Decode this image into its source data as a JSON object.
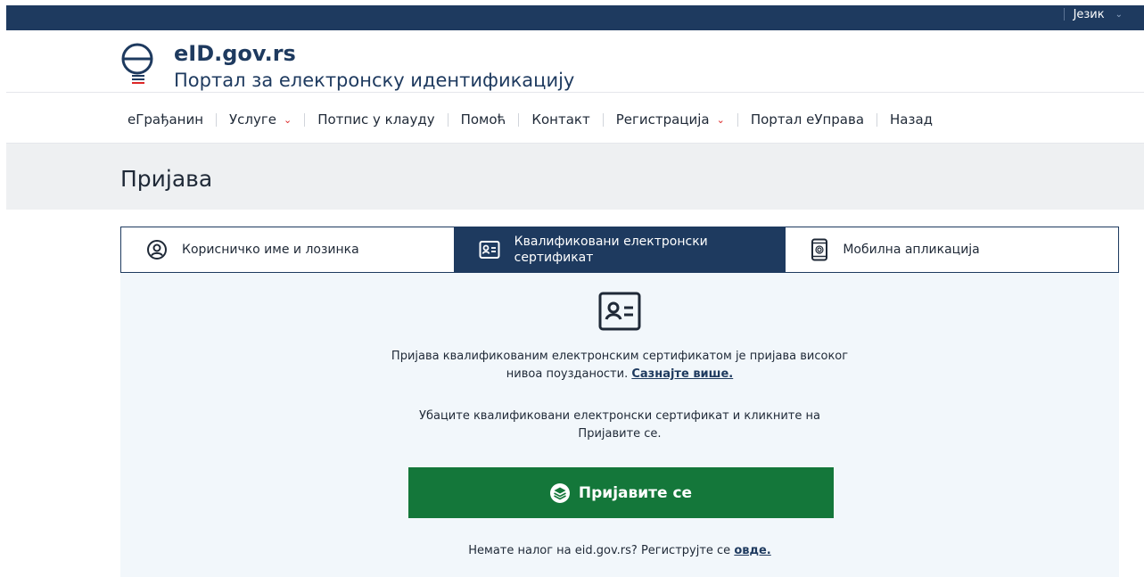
{
  "header": {
    "language_label": "Језик",
    "brand_title": "eID.gov.rs",
    "brand_subtitle": "Портал за електронску идентификацију"
  },
  "nav": {
    "items": [
      {
        "label": "еГрађанин",
        "dropdown": false
      },
      {
        "label": "Услуге",
        "dropdown": true
      },
      {
        "label": "Потпис у клауду",
        "dropdown": false
      },
      {
        "label": "Помоћ",
        "dropdown": false
      },
      {
        "label": "Контакт",
        "dropdown": false
      },
      {
        "label": "Регистрација",
        "dropdown": true
      },
      {
        "label": "Портал еУправа",
        "dropdown": false
      },
      {
        "label": "Назад",
        "dropdown": false
      }
    ]
  },
  "page": {
    "title": "Пријава"
  },
  "tabs": [
    {
      "label": "Корисничко име и лозинка",
      "icon": "user-circle-icon",
      "active": false
    },
    {
      "label": "Квалификовани електронски сертификат",
      "icon": "id-card-icon",
      "active": true
    },
    {
      "label": "Мобилна апликација",
      "icon": "mobile-fingerprint-icon",
      "active": false
    }
  ],
  "panel": {
    "info_text": "Пријава квалификованим електронским сертификатом је пријава високог нивоа поузданости.",
    "learn_more_link": "Сазнајте више.",
    "instruction_text": "Убаците квалификовани електронски сертификат и кликните на Пријавите се.",
    "login_button_label": "Пријавите се",
    "register_prompt": "Немате налог на eid.gov.rs? Региструјте се",
    "register_link": "овде."
  },
  "colors": {
    "navy": "#1e3a5f",
    "green": "#14773a",
    "accent_red": "#dc2626",
    "panel_bg": "#f2f7fb"
  }
}
